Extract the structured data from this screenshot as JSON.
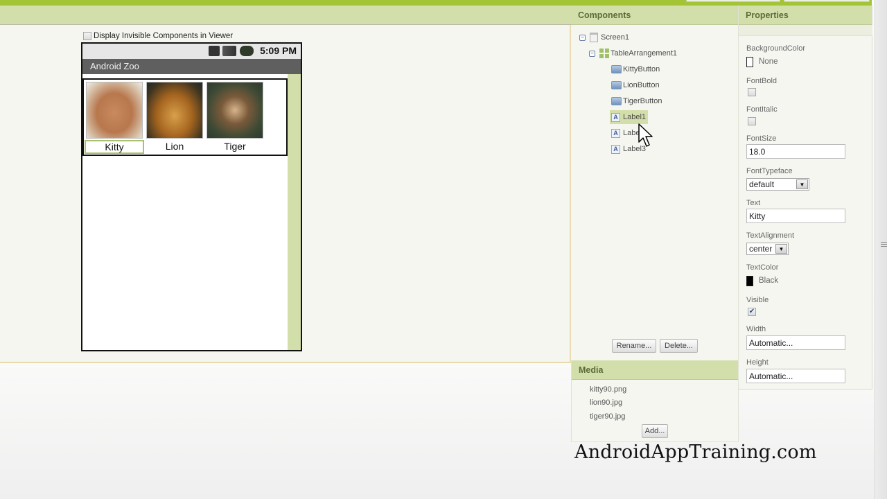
{
  "viewer": {
    "display_invisible_label": "Display Invisible Components in Viewer",
    "display_invisible_checked": false,
    "phone": {
      "status_time": "5:09 PM",
      "status_icons": [
        "sim-icon",
        "signal-icon",
        "battery-icon"
      ],
      "title": "Android Zoo",
      "animals": [
        {
          "label": "Kitty",
          "image": "kitty-image",
          "selected": true
        },
        {
          "label": "Lion",
          "image": "lion-image",
          "selected": false
        },
        {
          "label": "Tiger",
          "image": "tiger-image",
          "selected": false
        }
      ]
    }
  },
  "components": {
    "header": "Components",
    "tree": [
      {
        "label": "Screen1",
        "type": "screen",
        "toggle": "⊟"
      },
      {
        "label": "TableArrangement1",
        "type": "table",
        "toggle": "⊟"
      },
      {
        "label": "KittyButton",
        "type": "button"
      },
      {
        "label": "LionButton",
        "type": "button"
      },
      {
        "label": "TigerButton",
        "type": "button"
      },
      {
        "label": "Label1",
        "type": "label",
        "selected": true
      },
      {
        "label": "Label2",
        "type": "label"
      },
      {
        "label": "Label3",
        "type": "label"
      }
    ],
    "rename_label": "Rename...",
    "delete_label": "Delete..."
  },
  "media": {
    "header": "Media",
    "files": [
      "kitty90.png",
      "lion90.jpg",
      "tiger90.jpg"
    ],
    "add_label": "Add..."
  },
  "properties": {
    "header": "Properties",
    "background_color": {
      "label": "BackgroundColor",
      "value": "None",
      "swatch": "#ffffff"
    },
    "font_bold": {
      "label": "FontBold",
      "checked": false
    },
    "font_italic": {
      "label": "FontItalic",
      "checked": false
    },
    "font_size": {
      "label": "FontSize",
      "value": "18.0"
    },
    "font_typeface": {
      "label": "FontTypeface",
      "value": "default"
    },
    "text": {
      "label": "Text",
      "value": "Kitty"
    },
    "text_alignment": {
      "label": "TextAlignment",
      "value": "center"
    },
    "text_color": {
      "label": "TextColor",
      "value": "Black",
      "swatch": "#000000"
    },
    "visible": {
      "label": "Visible",
      "checked": true,
      "mark": "✔"
    },
    "width": {
      "label": "Width",
      "value": "Automatic..."
    },
    "height": {
      "label": "Height",
      "value": "Automatic..."
    }
  },
  "icons": {
    "label_glyph": "A",
    "dropdown_glyph": "▼"
  },
  "watermark": "AndroidAppTraining.com",
  "colors": {
    "accent_green": "#a3c434",
    "panel_header": "#d3dfaa",
    "selected_bg": "#d3dfaa"
  }
}
